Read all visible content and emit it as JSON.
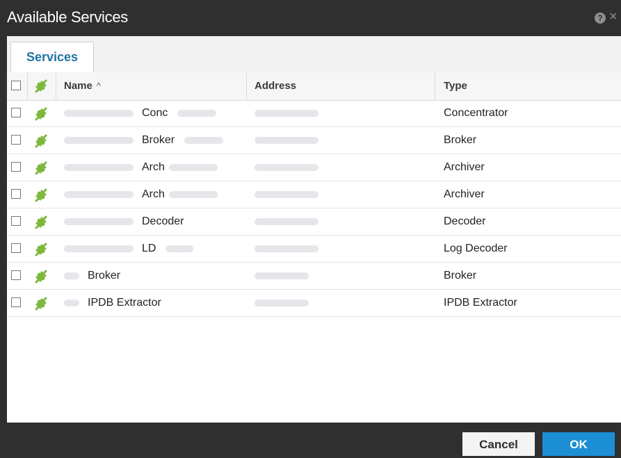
{
  "dialog": {
    "title": "Available Services",
    "help_icon": "?",
    "close_icon": "×"
  },
  "tabs": [
    {
      "label": "Services",
      "active": true
    }
  ],
  "table": {
    "columns": {
      "name": "Name",
      "name_sort": "^",
      "address": "Address",
      "type": "Type"
    },
    "rows": [
      {
        "name": "Conc",
        "type": "Concentrator"
      },
      {
        "name": "Broker",
        "type": "Broker"
      },
      {
        "name": "Arch",
        "type": "Archiver"
      },
      {
        "name": "Arch",
        "type": "Archiver"
      },
      {
        "name": "Decoder",
        "type": "Decoder"
      },
      {
        "name": "LD",
        "type": "Log Decoder"
      },
      {
        "name": "Broker",
        "type": "Broker"
      },
      {
        "name": "IPDB Extractor",
        "type": "IPDB Extractor"
      }
    ]
  },
  "footer": {
    "cancel_label": "Cancel",
    "ok_label": "OK"
  },
  "colors": {
    "titlebar": "#2f2f2f",
    "tab_text": "#1f72a4",
    "ok_button": "#1c8fd4",
    "plug_icon": "#7cb83a"
  }
}
